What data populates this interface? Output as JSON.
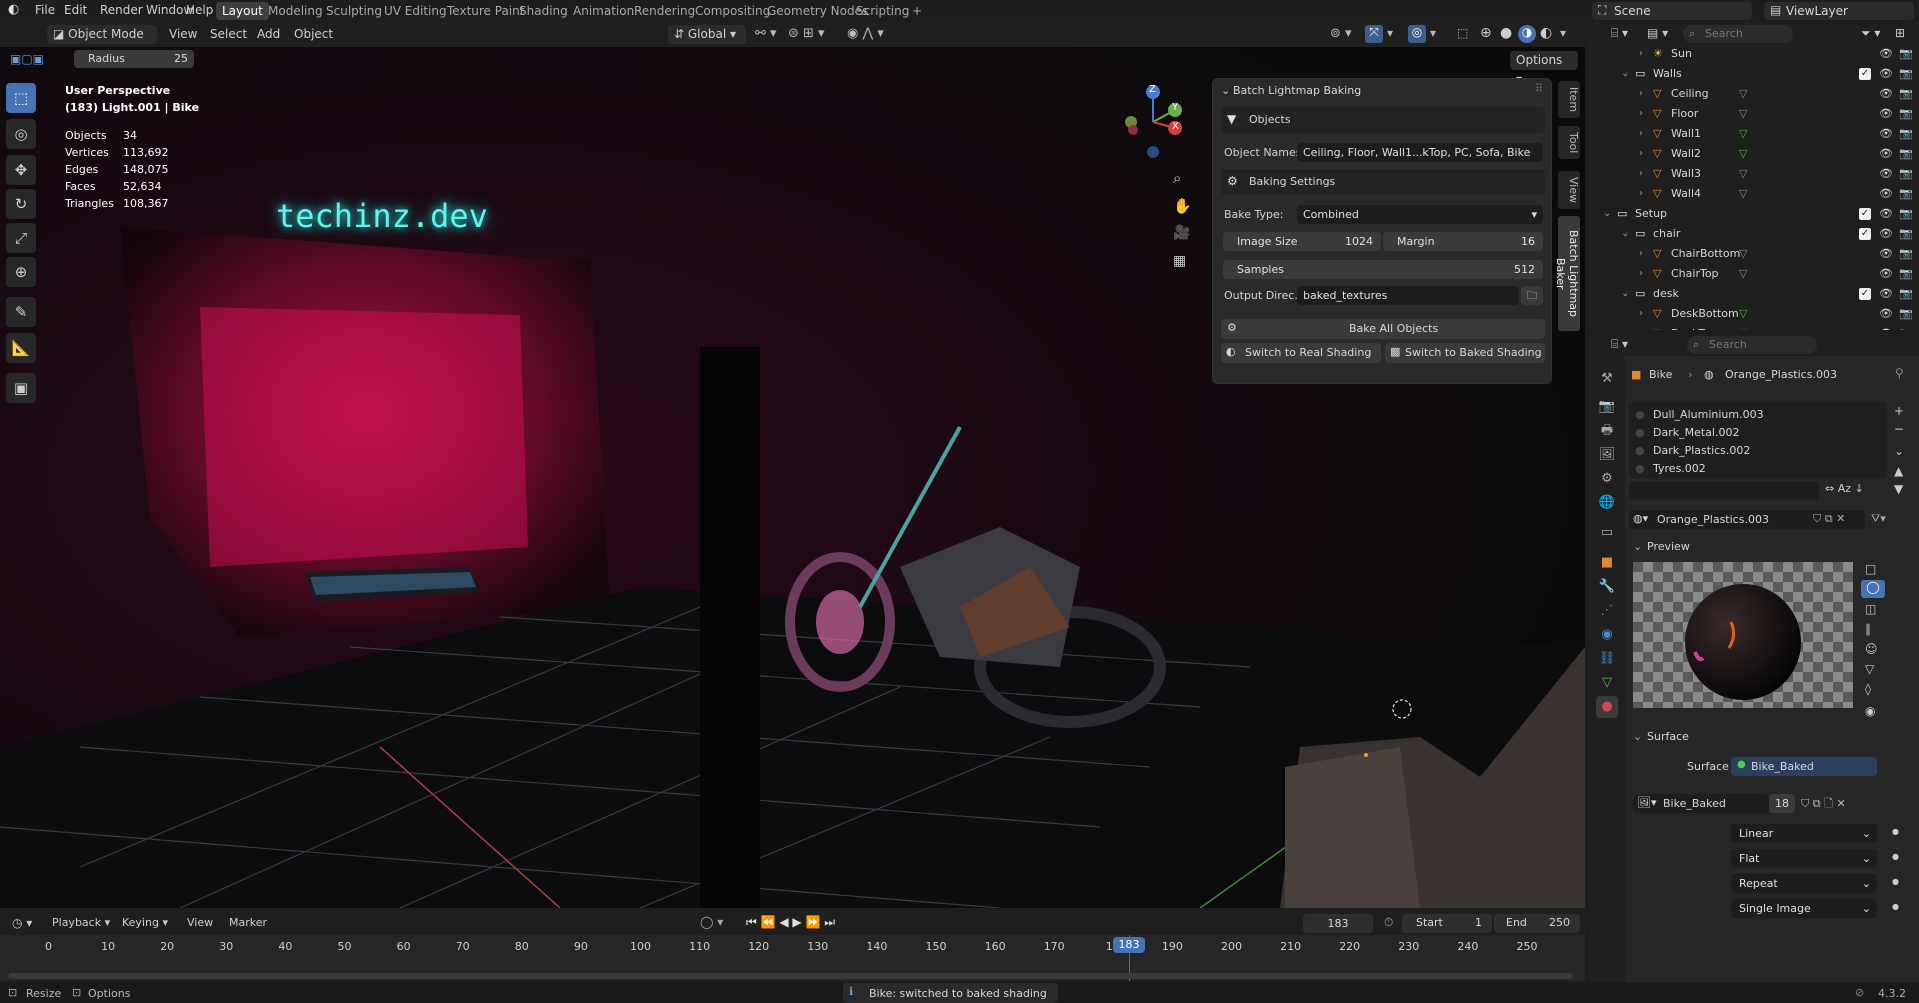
{
  "app": {
    "menus": [
      "File",
      "Edit",
      "Render",
      "Window",
      "Help"
    ],
    "workspaces": [
      "Layout",
      "Modeling",
      "Sculpting",
      "UV Editing",
      "Texture Paint",
      "Shading",
      "Animation",
      "Rendering",
      "Compositing",
      "Geometry Nodes",
      "Scripting"
    ],
    "active_workspace": "Layout",
    "add_workspace": "+",
    "scene": "Scene",
    "view_layer": "ViewLayer"
  },
  "header": {
    "mode": "Object Mode",
    "menus": [
      "View",
      "Select",
      "Add",
      "Object"
    ],
    "transform": "Global",
    "options": "Options"
  },
  "toolprops": {
    "radius_label": "Radius",
    "radius_value": "25"
  },
  "viewport": {
    "perspective": "User Perspective",
    "context": "(183) Light.001 | Bike",
    "stats": [
      {
        "label": "Objects",
        "value": "34"
      },
      {
        "label": "Vertices",
        "value": "113,692"
      },
      {
        "label": "Edges",
        "value": "148,075"
      },
      {
        "label": "Faces",
        "value": "52,634"
      },
      {
        "label": "Triangles",
        "value": "108,367"
      }
    ],
    "neon_sign": "techinz.dev",
    "gizmo_axes": [
      "Z",
      "Y",
      "X"
    ],
    "tools": [
      "select-box-icon",
      "cursor-icon",
      "move-icon",
      "rotate-icon",
      "scale-icon",
      "transform-icon",
      "annotate-icon",
      "measure-icon",
      "add-cube-icon"
    ]
  },
  "batch_panel": {
    "title": "Batch Lightmap Baking",
    "objects_section": "Objects",
    "object_names_label": "Object Names:",
    "object_names_value": "Ceiling, Floor, Wall1...kTop, PC, Sofa, Bike",
    "baking_section": "Baking Settings",
    "bake_type_label": "Bake Type:",
    "bake_type_value": "Combined",
    "image_size_label": "Image Size",
    "image_size_value": "1024",
    "margin_label": "Margin",
    "margin_value": "16",
    "samples_label": "Samples",
    "samples_value": "512",
    "output_label": "Output Direc...",
    "output_value": "baked_textures",
    "bake_all": "Bake All Objects",
    "switch_real": "Switch to Real Shading",
    "switch_baked": "Switch to Baked Shading"
  },
  "side_tabs": [
    "Item",
    "Tool",
    "View",
    "Batch Lightmap Baker"
  ],
  "outliner": {
    "search_placeholder": "Search",
    "rows": [
      {
        "name": "Sun",
        "indent": 2,
        "type": "light"
      },
      {
        "name": "Walls",
        "indent": 1,
        "type": "collection",
        "check": true
      },
      {
        "name": "Ceiling",
        "indent": 2,
        "type": "mesh"
      },
      {
        "name": "Floor",
        "indent": 2,
        "type": "mesh"
      },
      {
        "name": "Wall1",
        "indent": 2,
        "type": "mesh"
      },
      {
        "name": "Wall2",
        "indent": 2,
        "type": "mesh"
      },
      {
        "name": "Wall3",
        "indent": 2,
        "type": "mesh"
      },
      {
        "name": "Wall4",
        "indent": 2,
        "type": "mesh"
      },
      {
        "name": "Setup",
        "indent": 0,
        "type": "collection",
        "check": true
      },
      {
        "name": "chair",
        "indent": 1,
        "type": "collection",
        "check": true
      },
      {
        "name": "ChairBottom",
        "indent": 2,
        "type": "mesh"
      },
      {
        "name": "ChairTop",
        "indent": 2,
        "type": "mesh"
      },
      {
        "name": "desk",
        "indent": 1,
        "type": "collection",
        "check": true
      },
      {
        "name": "DeskBottom",
        "indent": 2,
        "type": "mesh"
      },
      {
        "name": "DeskTop",
        "indent": 2,
        "type": "mesh"
      }
    ]
  },
  "properties": {
    "search_placeholder": "Search",
    "breadcrumb_object": "Bike",
    "breadcrumb_material": "Orange_Plastics.003",
    "slots": [
      "Dull_Aluminium.003",
      "Dark_Metal.002",
      "Dark_Plastics.002",
      "Tyres.002"
    ],
    "material_name": "Orange_Plastics.003",
    "preview_label": "Preview",
    "surface_section": "Surface",
    "surface_label": "Surface",
    "surface_value": "Bike_Baked",
    "image_name": "Bike_Baked",
    "image_users": "18",
    "interp": "Linear",
    "projection": "Flat",
    "extension": "Repeat",
    "source": "Single Image"
  },
  "timeline": {
    "menus": [
      "Playback",
      "Keying",
      "View",
      "Marker"
    ],
    "current_frame": "183",
    "start_label": "Start",
    "start": "1",
    "end_label": "End",
    "end": "250",
    "ticks": [
      "0",
      "10",
      "20",
      "30",
      "40",
      "50",
      "60",
      "70",
      "80",
      "90",
      "100",
      "110",
      "120",
      "130",
      "140",
      "150",
      "160",
      "170",
      "18",
      "190",
      "200",
      "210",
      "220",
      "230",
      "240",
      "250"
    ],
    "playhead": "183"
  },
  "status": {
    "resize": "Resize",
    "options": "Options",
    "message": "Bike: switched to baked shading",
    "version": "4.3.2"
  },
  "colors": {
    "accent": "#4673b3",
    "neon": "#5ff5ef",
    "wall_glow": "#ff1f63"
  }
}
